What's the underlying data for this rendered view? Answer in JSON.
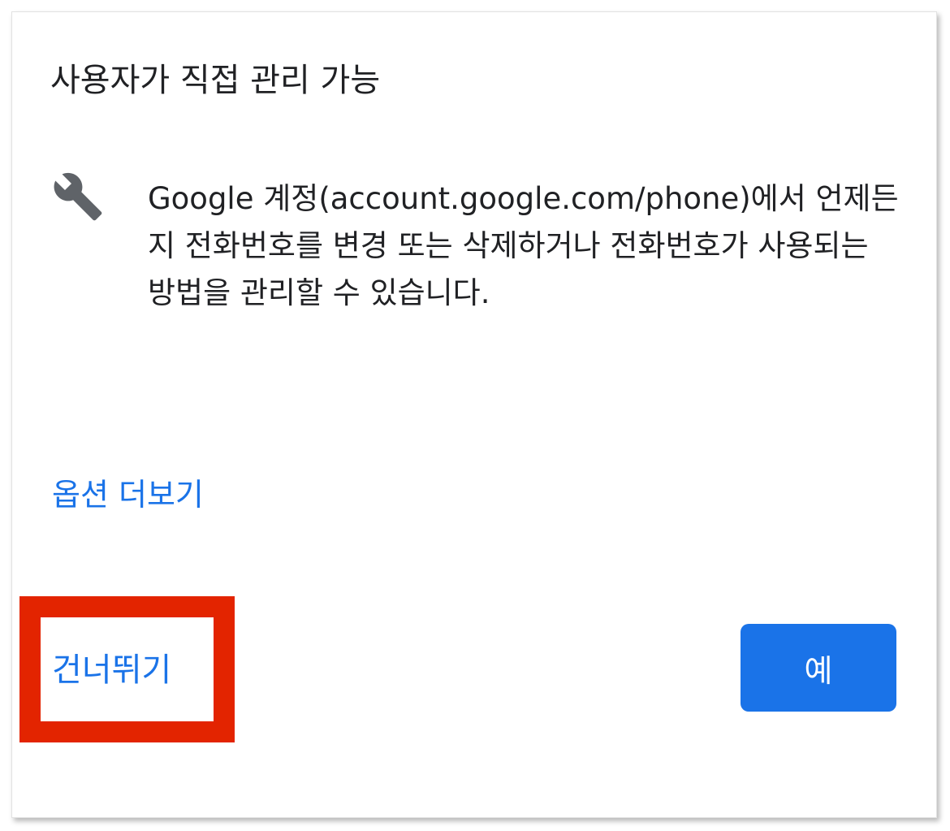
{
  "dialog": {
    "title": "사용자가 직접 관리 가능",
    "icon": "wrench-icon",
    "body": "Google 계정(account.google.com/phone)에서 언제든지 전화번호를 변경 또는 삭제하거나 전화번호가 사용되는 방법을 관리할 수 있습니다.",
    "more_options_label": "옵션 더보기",
    "skip_label": "건너뛰기",
    "yes_label": "예"
  },
  "colors": {
    "accent": "#1a73e8",
    "text": "#202124",
    "icon": "#5f6368",
    "highlight": "#e32400"
  }
}
